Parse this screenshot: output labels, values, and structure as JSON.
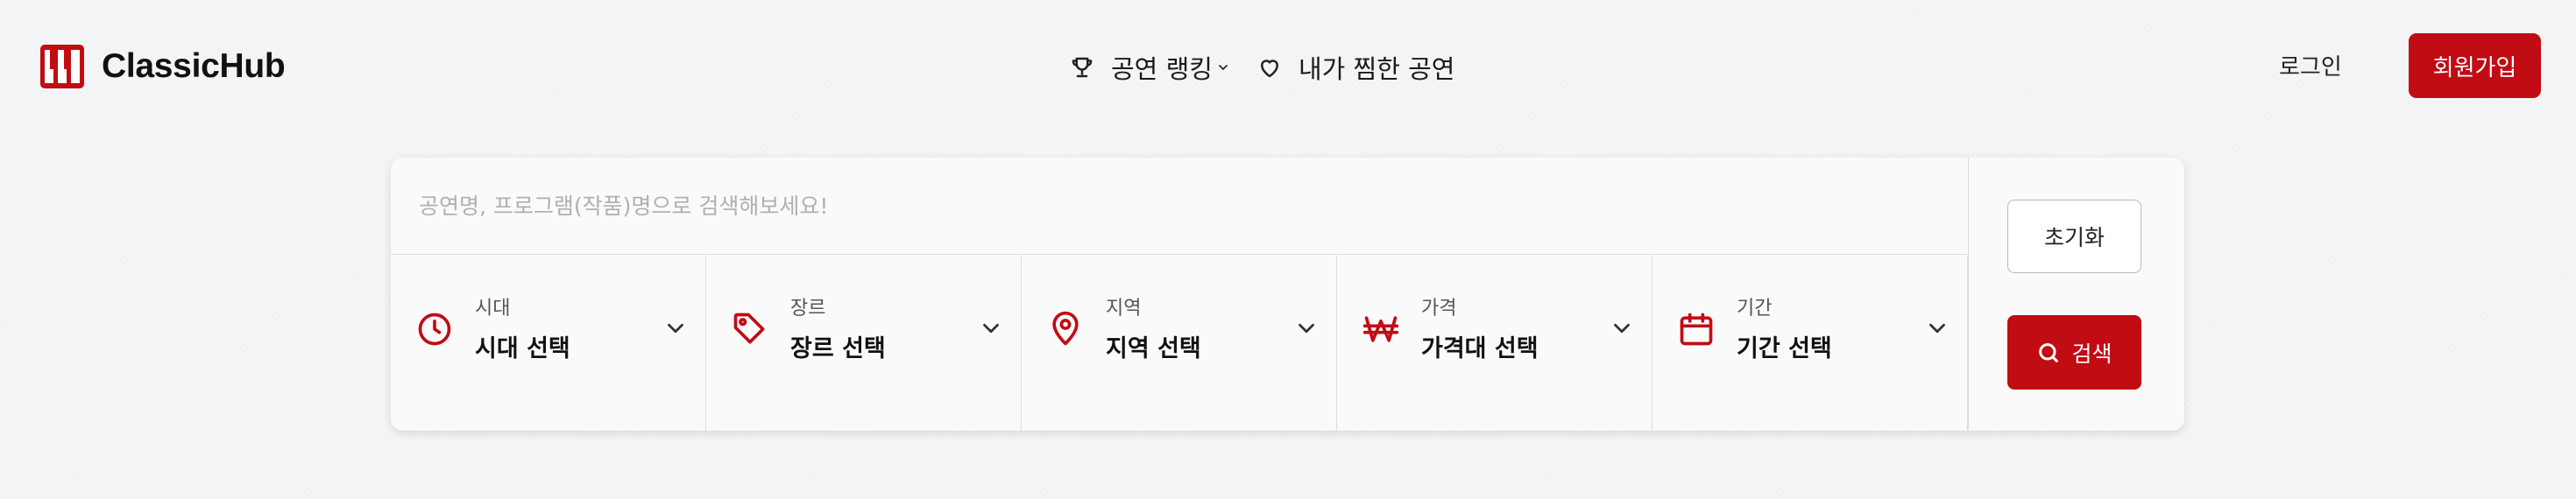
{
  "brand": {
    "name": "ClassicHub",
    "logo_icon": "piano-keys-icon",
    "accent": "#c20c13"
  },
  "nav": {
    "ranking": {
      "label": "공연 랭킹",
      "icon": "trophy-icon"
    },
    "wishlist": {
      "label": "내가 찜한 공연",
      "icon": "heart-icon"
    }
  },
  "auth": {
    "login_label": "로그인",
    "signup_label": "회원가입"
  },
  "search": {
    "placeholder": "공연명, 프로그램(작품)명으로 검색해보세요!",
    "value": "",
    "reset_label": "초기화",
    "search_label": "검색"
  },
  "filters": [
    {
      "label": "시대",
      "value": "시대 선택",
      "icon": "clock-icon"
    },
    {
      "label": "장르",
      "value": "장르 선택",
      "icon": "tag-icon"
    },
    {
      "label": "지역",
      "value": "지역 선택",
      "icon": "map-pin-icon"
    },
    {
      "label": "가격",
      "value": "가격대 선택",
      "icon": "won-icon"
    },
    {
      "label": "기간",
      "value": "기간 선택",
      "icon": "calendar-icon"
    }
  ]
}
